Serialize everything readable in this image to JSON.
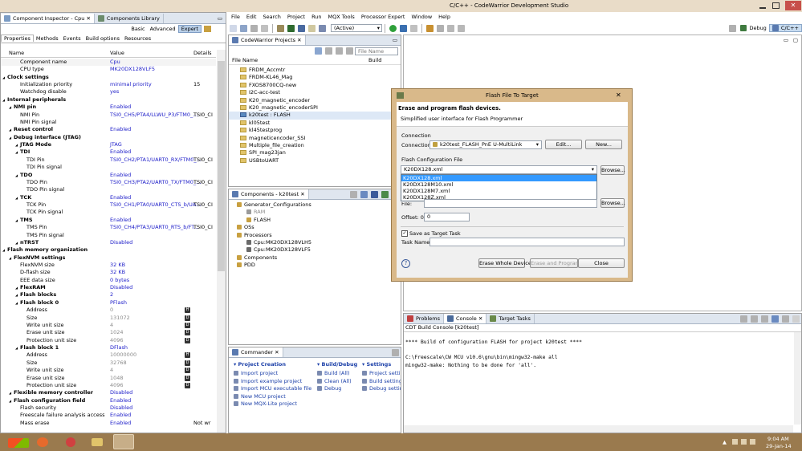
{
  "window": {
    "title": "C/C++ - CodeWarrior Development Studio"
  },
  "menu": [
    "File",
    "Edit",
    "Search",
    "Project",
    "Run",
    "MQX Tools",
    "Processor Expert",
    "Window",
    "Help"
  ],
  "toolbar": {
    "config_value": "(Active)",
    "perspectives": [
      "Debug",
      "C/C++"
    ]
  },
  "inspector": {
    "tabs": [
      "Component Inspector - Cpu",
      "Components Library"
    ],
    "modes": [
      "Basic",
      "Advanced",
      "Expert"
    ],
    "subtabs": [
      "Properties",
      "Methods",
      "Events",
      "Build options",
      "Resources"
    ],
    "headers": [
      "Name",
      "Value",
      "Details"
    ],
    "rows": [
      {
        "name": "Component name",
        "value": "Cpu",
        "detail": "",
        "badge": ""
      },
      {
        "name": "CPU type",
        "value": "MK20DX128VLF5",
        "detail": "",
        "badge": ""
      },
      {
        "name": "Clock settings",
        "value": "",
        "detail": "",
        "badge": ""
      },
      {
        "name": "Initialization priority",
        "value": "minimal priority",
        "detail": "15",
        "badge": ""
      },
      {
        "name": "Watchdog disable",
        "value": "yes",
        "detail": "",
        "badge": ""
      },
      {
        "name": "Internal peripherals",
        "value": "",
        "detail": "",
        "badge": ""
      },
      {
        "name": "NMI pin",
        "value": "Enabled",
        "detail": "",
        "badge": ""
      },
      {
        "name": "NMI Pin",
        "value": "TSI0_CH5/PTA4/LLWU_P3/FTM0_...",
        "detail": "TSI0_CI",
        "badge": ""
      },
      {
        "name": "NMI Pin signal",
        "value": "",
        "detail": "",
        "badge": ""
      },
      {
        "name": "Reset control",
        "value": "Enabled",
        "detail": "",
        "badge": ""
      },
      {
        "name": "Debug interface (JTAG)",
        "value": "",
        "detail": "",
        "badge": ""
      },
      {
        "name": "JTAG Mode",
        "value": "JTAG",
        "detail": "",
        "badge": ""
      },
      {
        "name": "TDI",
        "value": "Enabled",
        "detail": "",
        "badge": ""
      },
      {
        "name": "TDI Pin",
        "value": "TSI0_CH2/PTA1/UART0_RX/FTM0_...",
        "detail": "TSI0_CI",
        "badge": ""
      },
      {
        "name": "TDI Pin signal",
        "value": "",
        "detail": "",
        "badge": ""
      },
      {
        "name": "TDO",
        "value": "Enabled",
        "detail": "",
        "badge": ""
      },
      {
        "name": "TDO Pin",
        "value": "TSI0_CH3/PTA2/UART0_TX/FTM0_...",
        "detail": "TSI0_CI",
        "badge": ""
      },
      {
        "name": "TDO Pin signal",
        "value": "",
        "detail": "",
        "badge": ""
      },
      {
        "name": "TCK",
        "value": "Enabled",
        "detail": "",
        "badge": ""
      },
      {
        "name": "TCK Pin",
        "value": "TSI0_CH1/PTA0/UART0_CTS_b/UA...",
        "detail": "TSI0_CI",
        "badge": ""
      },
      {
        "name": "TCK Pin signal",
        "value": "",
        "detail": "",
        "badge": ""
      },
      {
        "name": "TMS",
        "value": "Enabled",
        "detail": "",
        "badge": ""
      },
      {
        "name": "TMS Pin",
        "value": "TSI0_CH4/PTA3/UART0_RTS_b/FT...",
        "detail": "TSI0_CI",
        "badge": ""
      },
      {
        "name": "TMS Pin signal",
        "value": "",
        "detail": "",
        "badge": ""
      },
      {
        "name": "nTRST",
        "value": "Disabled",
        "detail": "",
        "badge": ""
      },
      {
        "name": "Flash memory organization",
        "value": "",
        "detail": "",
        "badge": ""
      },
      {
        "name": "FlexNVM settings",
        "value": "",
        "detail": "",
        "badge": ""
      },
      {
        "name": "FlexNVM size",
        "value": "32 KB",
        "detail": "",
        "badge": ""
      },
      {
        "name": "D-flash size",
        "value": "32 KB",
        "detail": "",
        "badge": ""
      },
      {
        "name": "EEE data size",
        "value": "0 bytes",
        "detail": "",
        "badge": ""
      },
      {
        "name": "FlexRAM",
        "value": "Disabled",
        "detail": "",
        "badge": ""
      },
      {
        "name": "Flash blocks",
        "value": "2",
        "detail": "",
        "badge": ""
      },
      {
        "name": "Flash block 0",
        "value": "PFlash",
        "detail": "",
        "badge": ""
      },
      {
        "name": "Address",
        "value": "0",
        "detail": "",
        "badge": "H"
      },
      {
        "name": "Size",
        "value": "131072",
        "detail": "",
        "badge": "D"
      },
      {
        "name": "Write unit size",
        "value": "4",
        "detail": "",
        "badge": "D"
      },
      {
        "name": "Erase unit size",
        "value": "1024",
        "detail": "",
        "badge": "D"
      },
      {
        "name": "Protection unit size",
        "value": "4096",
        "detail": "",
        "badge": "D"
      },
      {
        "name": "Flash block 1",
        "value": "DFlash",
        "detail": "",
        "badge": ""
      },
      {
        "name": "Address",
        "value": "10000000",
        "detail": "",
        "badge": "H"
      },
      {
        "name": "Size",
        "value": "32768",
        "detail": "",
        "badge": "D"
      },
      {
        "name": "Write unit size",
        "value": "4",
        "detail": "",
        "badge": "D"
      },
      {
        "name": "Erase unit size",
        "value": "1048",
        "detail": "",
        "badge": "D"
      },
      {
        "name": "Protection unit size",
        "value": "4096",
        "detail": "",
        "badge": "D"
      },
      {
        "name": "Flexible memory controller",
        "value": "Disabled",
        "detail": "",
        "badge": ""
      },
      {
        "name": "Flash configuration field",
        "value": "Enabled",
        "detail": "",
        "badge": ""
      },
      {
        "name": "Flash security",
        "value": "Disabled",
        "detail": "",
        "badge": ""
      },
      {
        "name": "Freescale failure analysis access",
        "value": "Enabled",
        "detail": "",
        "badge": ""
      },
      {
        "name": "Mass erase",
        "value": "Enabled",
        "detail": "Not wr",
        "badge": ""
      }
    ]
  },
  "projects": {
    "title": "CodeWarrior Projects",
    "col_file": "File Name",
    "col_build": "Build",
    "filter_placeholder": "File Name",
    "items": [
      "FRDM_Accmtr",
      "FRDM-KL46_Mag",
      "FXOS8700CQ-new",
      "I2C-acc-test",
      "K20_magnetic_encoder",
      "K20_magnetic_encoderSPI",
      "k20test  : FLASH",
      "kl05test",
      "kl45testprog",
      "magneticencoder_SSI",
      "Multiple_file_creation",
      "SPI_mag23jan",
      "USBtoUART"
    ]
  },
  "components": {
    "title": "Components - k20test",
    "items": [
      "Generator_Configurations",
      "RAM",
      "FLASH",
      "OSs",
      "Processors",
      "Cpu:MK20DX128VLH5",
      "Cpu:MK20DX128VLF5",
      "Components",
      "PDD"
    ]
  },
  "commander": {
    "title": "Commander",
    "sections": [
      {
        "header": "Project Creation",
        "items": [
          "Import project",
          "Import example project",
          "Import MCU executable file",
          "New MCU project",
          "New MQX-Lite project"
        ]
      },
      {
        "header": "Build/Debug",
        "items": [
          "Build  (All)",
          "Clean  (All)",
          "Debug"
        ]
      },
      {
        "header": "Settings",
        "items": [
          "Project settings",
          "Build settings",
          "Debug settings"
        ]
      }
    ]
  },
  "console": {
    "tabs": [
      "Problems",
      "Console",
      "Target Tasks"
    ],
    "subtitle": "CDT Build Console [k20test]",
    "lines": [
      "**** Build of configuration FLASH for project k20test ****",
      "",
      "C:\\Freescale\\CW MCU v10.6\\gnu\\bin\\mingw32-make all",
      "mingw32-make: Nothing to be done for 'all'."
    ]
  },
  "dialog": {
    "title": "Flash File To Target",
    "heading": "Erase and program flash devices.",
    "subheading": "Simplified user interface for Flash Programmer",
    "connection_group": "Connection",
    "connection_label": "Connection:",
    "connection_value": "k20test_FLASH_PnE U-MultiLink",
    "edit_label": "Edit...",
    "new_label": "New...",
    "flash_cfg_label": "Flash Configuration File",
    "flash_cfg_value": "K20DX128.xml",
    "browse_label": "Browse...",
    "dropdown_options": [
      "K20DX128.xml",
      "K20DX128M10.xml",
      "K20DX128M7.xml",
      "K20DX128Z.xml"
    ],
    "file_label": "File:",
    "offset_label": "Offset: 0x",
    "offset_value": "0",
    "save_task_label": "Save as Target Task",
    "task_name_label": "Task Name:",
    "erase_label": "Erase Whole Device",
    "program_label": "Erase and Program",
    "close_label": "Close"
  },
  "taskbar": {
    "time": "9:04 AM",
    "date": "29-Jan-14"
  }
}
